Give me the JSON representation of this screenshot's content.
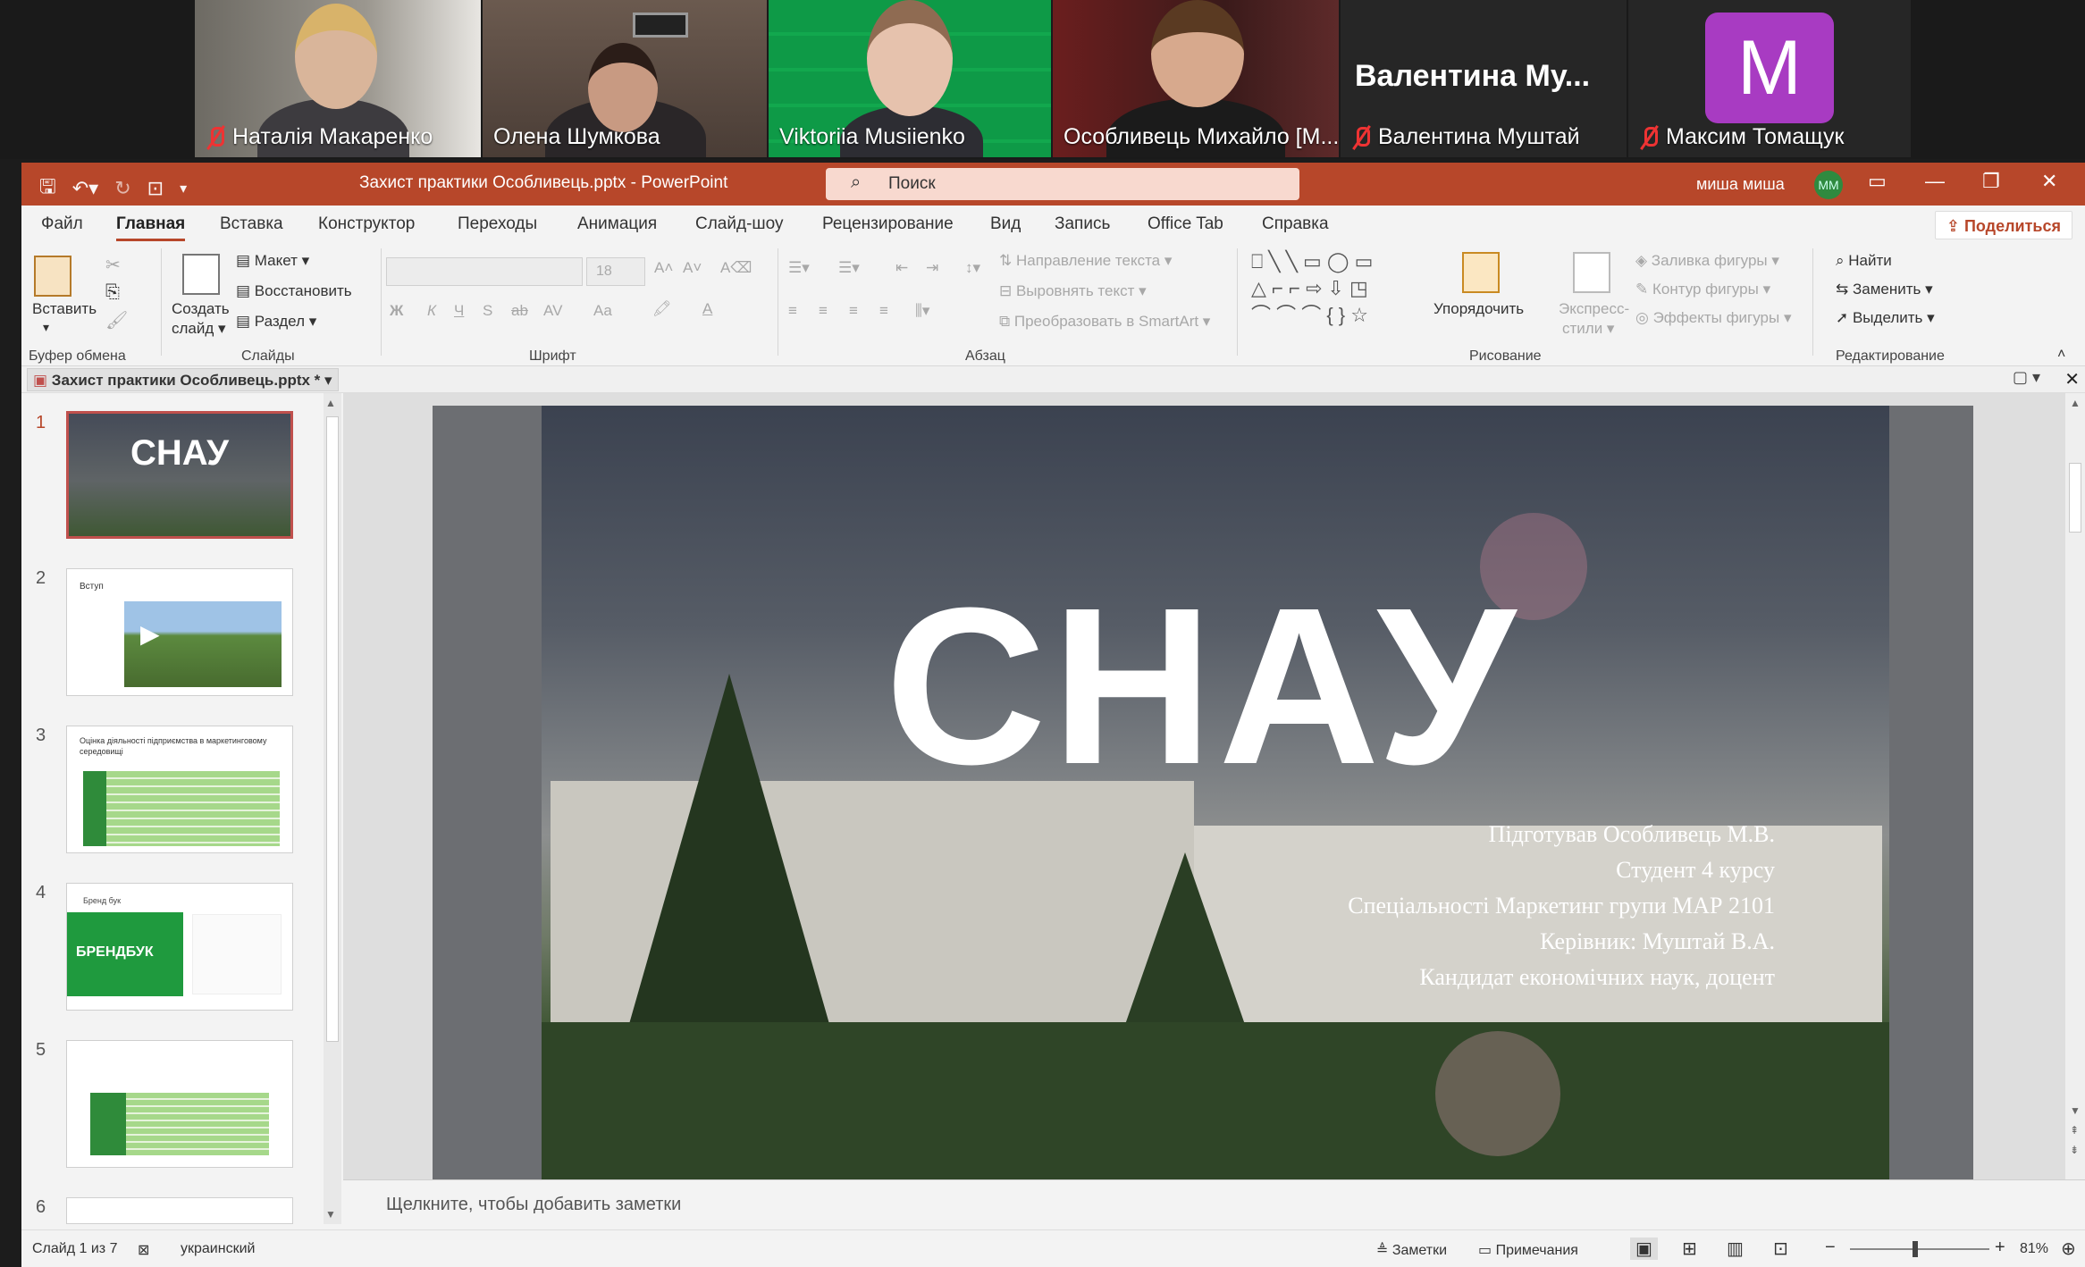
{
  "participants": [
    {
      "name": "Наталія Макаренко",
      "muted": true
    },
    {
      "name": "Олена Шумкова",
      "muted": false
    },
    {
      "name": "Viktoriia Musiienko",
      "muted": false
    },
    {
      "name": "Особливець Михайло [М...",
      "muted": false
    },
    {
      "name": "Валентина Муштай",
      "muted": true,
      "display_name": "Валентина  Му..."
    },
    {
      "name": "Максим Томащук",
      "muted": true,
      "avatar_letter": "M"
    }
  ],
  "window": {
    "title": "Захист практики Особливець.pptx  -  PowerPoint",
    "search_placeholder": "Поиск",
    "user": "миша миша",
    "user_initials": "MM",
    "share_label": "Поделиться"
  },
  "tabs": [
    "Файл",
    "Главная",
    "Вставка",
    "Конструктор",
    "Переходы",
    "Анимация",
    "Слайд-шоу",
    "Рецензирование",
    "Вид",
    "Запись",
    "Office Tab",
    "Справка"
  ],
  "ribbon": {
    "paste": "Вставить",
    "create_slide": "Создать",
    "create_slide2": "слайд",
    "layout": "Макет",
    "restore": "Восстановить",
    "section": "Раздел",
    "font_size": "18",
    "text_direction": "Направление текста",
    "align_text": "Выровнять текст",
    "smartart": "Преобразовать в SmartArt",
    "arrange": "Упорядочить",
    "quick_styles": "Экспресс-",
    "quick_styles2": "стили",
    "shape_fill": "Заливка фигуры",
    "shape_outline": "Контур фигуры",
    "shape_effects": "Эффекты фигуры",
    "find": "Найти",
    "replace": "Заменить",
    "select": "Выделить",
    "groups": {
      "clipboard": "Буфер обмена",
      "slides": "Слайды",
      "font": "Шрифт",
      "paragraph": "Абзац",
      "drawing": "Рисование",
      "editing": "Редактирование"
    }
  },
  "document_tab": "Захист практики Особливець.pptx *",
  "thumbnails": [
    {
      "num": "1",
      "label": "СНАУ"
    },
    {
      "num": "2",
      "label": "Вступ"
    },
    {
      "num": "3",
      "label": "Оцінка діяльності підприємства в маркетинговому середовищі"
    },
    {
      "num": "4",
      "label": "Бренд бук",
      "inner": "БРЕНДБУК"
    },
    {
      "num": "5",
      "label": ""
    },
    {
      "num": "6",
      "label": ""
    }
  ],
  "slide": {
    "title": "СНАУ",
    "lines": [
      "Підготував Особливець М.В.",
      "Студент 4 курсу",
      "Спеціальності Маркетинг групи МАР 2101",
      "Керівник: Муштай В.А.",
      "Кандидат економічних наук, доцент"
    ]
  },
  "notes_placeholder": "Щелкните, чтобы добавить заметки",
  "status": {
    "slide_count": "Слайд 1 из 7",
    "language": "украинский",
    "notes": "Заметки",
    "comments": "Примечания",
    "zoom": "81%"
  },
  "colors": {
    "accent": "#b7472a",
    "active_speaker": "#23d160",
    "avatar": "#a83bc2"
  }
}
